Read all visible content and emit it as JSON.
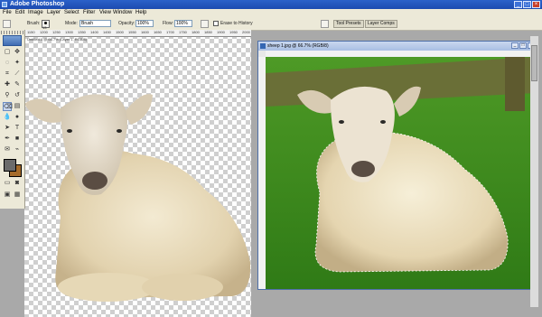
{
  "window": {
    "title": "Adobe Photoshop"
  },
  "menu": [
    "File",
    "Edit",
    "Image",
    "Layer",
    "Select",
    "Filter",
    "View",
    "Window",
    "Help"
  ],
  "options_bar": {
    "brush_label": "Brush:",
    "brush_size": "13",
    "mode_label": "Mode:",
    "mode_value": "Brush",
    "opacity_label": "Opacity:",
    "opacity_value": "100%",
    "flow_label": "Flow:",
    "flow_value": "100%",
    "erase_history_label": "Erase to History",
    "tabs": [
      "Tool Presets",
      "Layer Comps"
    ]
  },
  "documents": {
    "left_title": "Untitled-1 @ 66.7% (Layer 1, RGB/8)",
    "left_ruler": [
      "1150",
      "1200",
      "1250",
      "1300",
      "1350",
      "1400",
      "1450",
      "1500",
      "1550",
      "1600",
      "1650",
      "1700",
      "1750",
      "1800",
      "1850",
      "1900",
      "1950",
      "2000"
    ],
    "right_title": "sheep 1.jpg @ 66.7% (RGB/8)"
  },
  "colors": {
    "foreground": "#6b6b6b",
    "background": "#a56b2a",
    "grass": "#3a8a1d",
    "fence": "#6e6a3a"
  }
}
